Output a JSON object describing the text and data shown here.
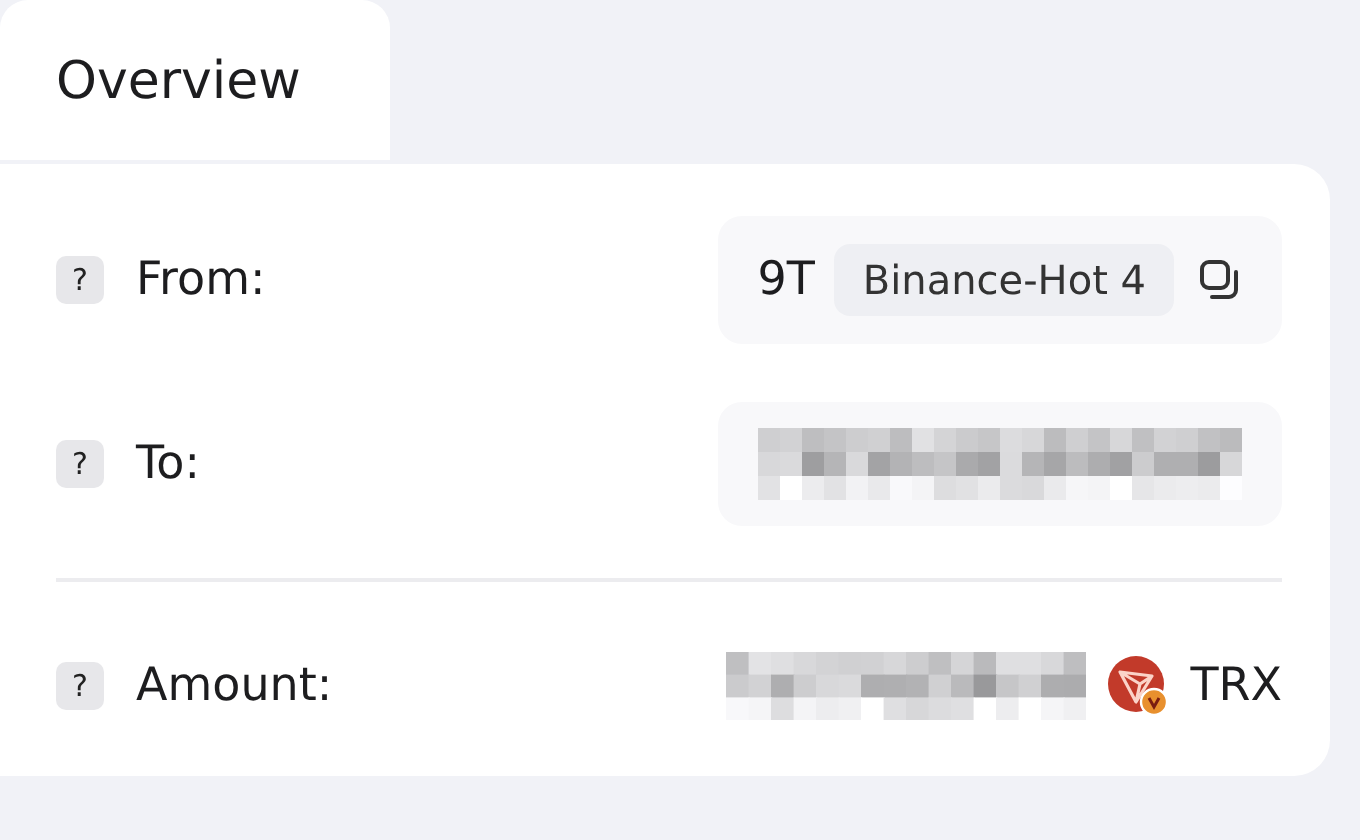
{
  "tabs": [
    {
      "label": "Overview",
      "selected": true
    }
  ],
  "rows": [
    {
      "help": "?",
      "label": "From:",
      "value": {
        "kind": "address_tag",
        "text": "9T",
        "tag": "Binance-Hot 4"
      }
    },
    {
      "help": "?",
      "label": "To:",
      "value": {
        "kind": "redacted"
      }
    },
    {
      "help": "?",
      "label": "Amount:",
      "value": {
        "kind": "amount",
        "unit": "TRX"
      }
    }
  ]
}
